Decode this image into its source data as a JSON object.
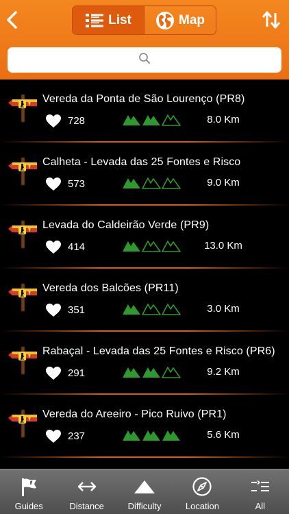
{
  "header": {
    "tabs": [
      {
        "label": "List",
        "active": true
      },
      {
        "label": "Map",
        "active": false
      }
    ],
    "search": {
      "placeholder": "",
      "value": ""
    },
    "accent_color": "#f07a1a"
  },
  "routes": [
    {
      "name": "Vereda da Ponta de São Lourenço (PR8)",
      "likes": "728",
      "difficulty": 2,
      "distance": "8.0 Km"
    },
    {
      "name": "Calheta - Levada das 25 Fontes e Risco",
      "likes": "573",
      "difficulty": 1,
      "distance": "9.0 Km"
    },
    {
      "name": "Levada do Caldeirão Verde (PR9)",
      "likes": "414",
      "difficulty": 1,
      "distance": "13.0 Km"
    },
    {
      "name": "Vereda dos Balcões (PR11)",
      "likes": "351",
      "difficulty": 1,
      "distance": "3.0 Km"
    },
    {
      "name": "Rabaçal - Levada das 25 Fontes e Risco (PR6)",
      "likes": "291",
      "difficulty": 2,
      "distance": "9.2 Km"
    },
    {
      "name": "Vereda do Areeiro - Pico Ruivo (PR1)",
      "likes": "237",
      "difficulty": 3,
      "distance": "5.6 Km"
    }
  ],
  "tabbar": {
    "items": [
      {
        "label": "Guides",
        "icon": "flag-icon"
      },
      {
        "label": "Distance",
        "icon": "distance-arrows-icon"
      },
      {
        "label": "Difficulty",
        "icon": "mountain-icon"
      },
      {
        "label": "Location",
        "icon": "compass-icon"
      },
      {
        "label": "All",
        "icon": "list-all-icon"
      }
    ]
  },
  "difficulty_color": "#2e9a2e"
}
